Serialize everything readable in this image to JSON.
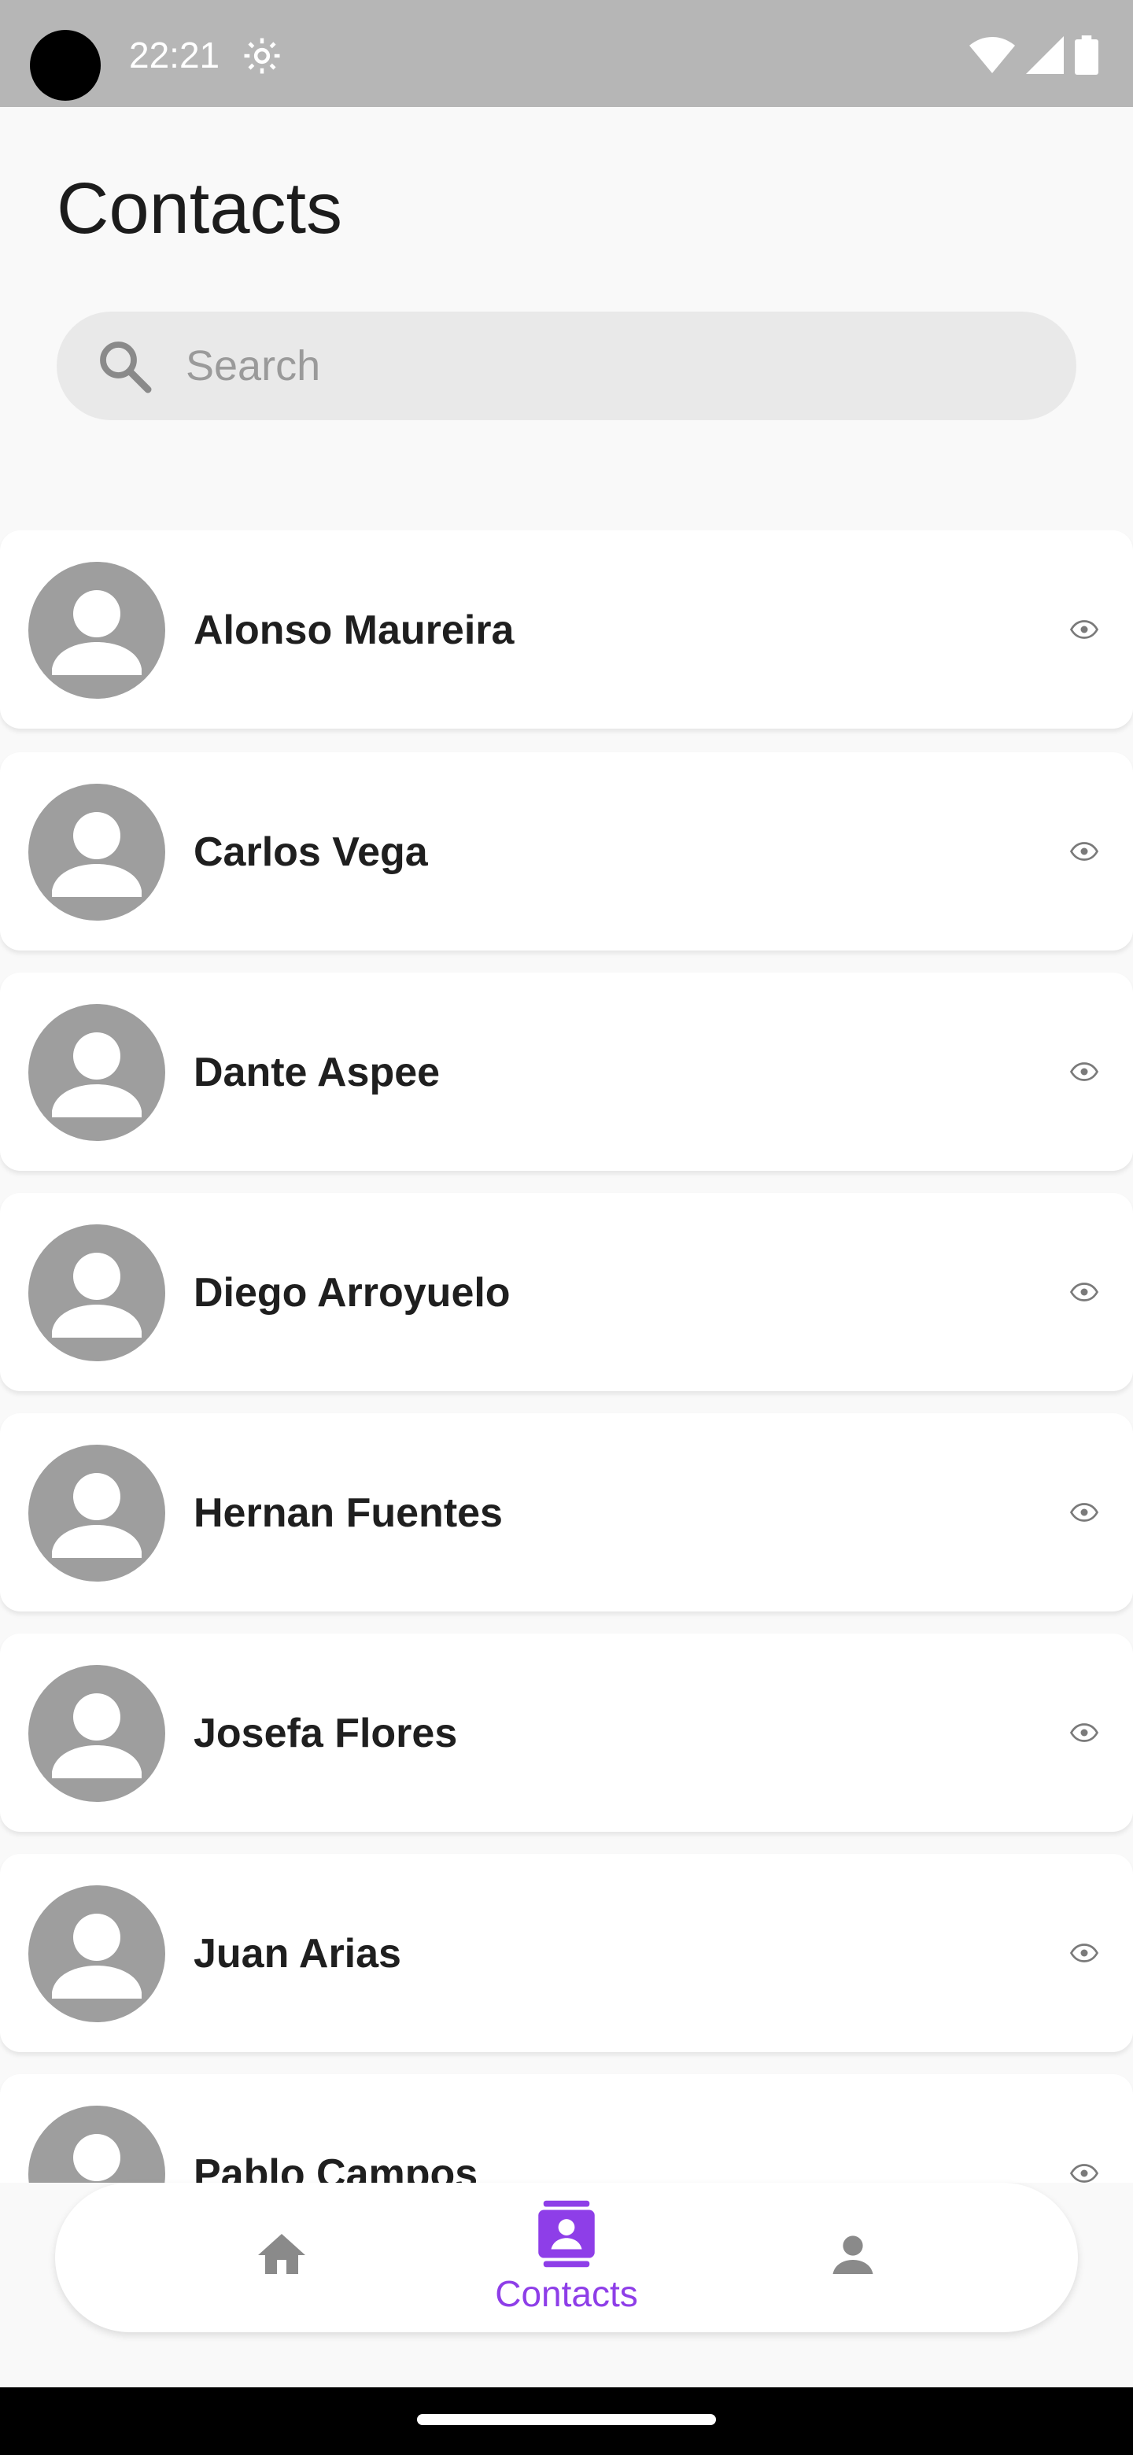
{
  "status_bar": {
    "time": "22:21",
    "icons": [
      "settings-gear-icon",
      "wifi-icon",
      "cellular-signal-icon",
      "battery-icon"
    ],
    "background_color": "#b6b6b6"
  },
  "header": {
    "title": "Contacts"
  },
  "search": {
    "placeholder": "Search",
    "value": ""
  },
  "contacts": [
    {
      "name": "Alonso Maureira"
    },
    {
      "name": "Carlos Vega"
    },
    {
      "name": "Dante Aspee"
    },
    {
      "name": "Diego Arroyuelo"
    },
    {
      "name": "Hernan Fuentes"
    },
    {
      "name": "Josefa Flores"
    },
    {
      "name": "Juan Arias"
    },
    {
      "name": "Pablo Campos"
    }
  ],
  "bottom_nav": {
    "items": [
      {
        "icon": "home-icon",
        "label": "",
        "active": false
      },
      {
        "icon": "contacts-icon",
        "label": "Contacts",
        "active": true
      },
      {
        "icon": "person-icon",
        "label": "",
        "active": false
      }
    ]
  },
  "colors": {
    "accent": "#8e3ee8",
    "inactive_icon": "#8a8a8a",
    "avatar_bg": "#9e9e9e",
    "card_bg": "#ffffff",
    "page_bg": "#f9f9f9"
  }
}
